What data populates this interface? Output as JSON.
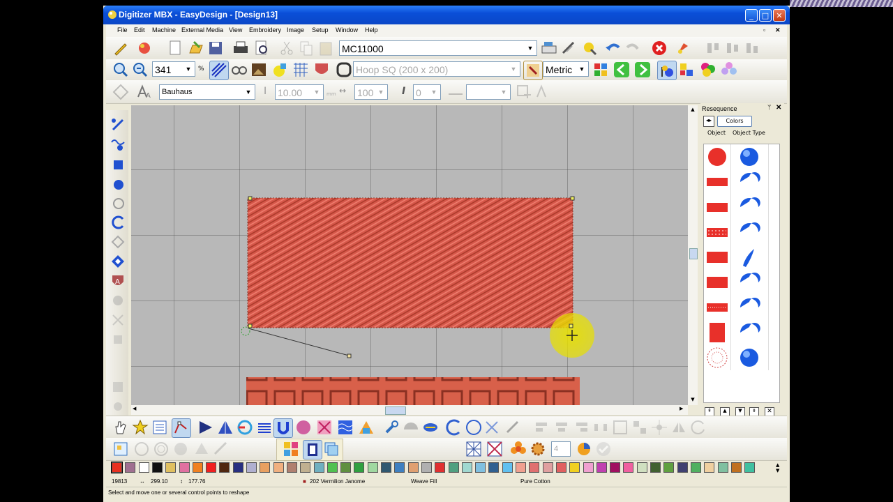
{
  "window": {
    "title": "Digitizer MBX - EasyDesign - [Design13]",
    "min": "_",
    "max": "□",
    "close": "✕"
  },
  "menu": [
    "File",
    "Edit",
    "Machine",
    "External Media",
    "View",
    "Embroidery",
    "Image",
    "Setup",
    "Window",
    "Help"
  ],
  "mdi": {
    "restore": "▫",
    "close": "✕"
  },
  "toolbar1": {
    "machine": "MC11000"
  },
  "toolbar2": {
    "zoom": "341",
    "zoom_unit": "%",
    "hoop": "Hoop SQ (200 x 200)",
    "units": "Metric"
  },
  "toolbar3": {
    "font": "Bauhaus",
    "height": "10.00",
    "height_unit": "mm",
    "width": "100",
    "slant": "0"
  },
  "resequence": {
    "title": "Resequence",
    "colors_label": "Colors",
    "col_object": "Object",
    "col_object_type": "Object Type",
    "rows": [
      {
        "object": "circle",
        "type": "circle"
      },
      {
        "object": "flat-rect",
        "type": "crescent"
      },
      {
        "object": "flat-rect",
        "type": "crescent"
      },
      {
        "object": "dotted-rect",
        "type": "crescent"
      },
      {
        "object": "flat-rect",
        "type": "swoosh"
      },
      {
        "object": "flat-rect",
        "type": "crescent"
      },
      {
        "object": "striped-rect",
        "type": "crescent"
      },
      {
        "object": "tall-rect",
        "type": "crescent"
      },
      {
        "object": "lace-circle",
        "type": "circle"
      }
    ]
  },
  "status": {
    "stitches": "19813",
    "width": "299.10",
    "height": "177.76",
    "thread": "202 Vermilion Janome",
    "fill": "Weave Fill",
    "fabric": "Pure Cotton"
  },
  "hint": "Select and move one or several control points to reshape",
  "counter": "4",
  "palette": [
    "#e83020",
    "#a07090",
    "#ffffff",
    "#101010",
    "#e0c060",
    "#e070a0",
    "#f08020",
    "#f02020",
    "#502810",
    "#283080",
    "#b0b0d0",
    "#e8a060",
    "#f0b080",
    "#b08070",
    "#c0b090",
    "#70b0c0",
    "#50c050",
    "#609040",
    "#30a040",
    "#a0d8a0",
    "#305870",
    "#4080c0",
    "#e0a070",
    "#b0b0b0",
    "#e03030",
    "#50a080",
    "#a0d8d0",
    "#80c0e0",
    "#306090",
    "#60c0f0",
    "#f0a090",
    "#e07070",
    "#e0a0a0",
    "#e06060",
    "#f0d020",
    "#f0a0d0",
    "#c040b0",
    "#a01060",
    "#f060a0",
    "#d0e0c0",
    "#406030",
    "#60a040",
    "#404070",
    "#50b060",
    "#f0d0a0",
    "#80c0a0",
    "#c07020",
    "#40c0a0"
  ],
  "colors": {
    "fill": "#d6574a",
    "canvas": "#b8b8b8",
    "highlight": "#e8e000"
  }
}
